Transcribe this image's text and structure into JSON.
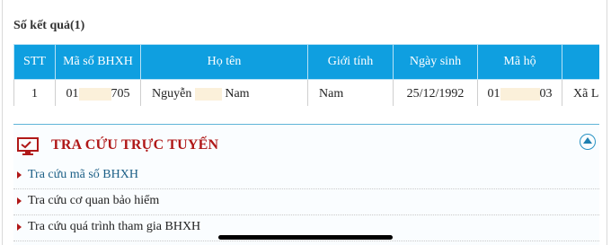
{
  "results": {
    "count_label": "Số kết quả(1)"
  },
  "table": {
    "headers": [
      "STT",
      "Mã số BHXH",
      "Họ tên",
      "Giới tính",
      "Ngày sinh",
      "Mã hộ",
      ""
    ],
    "row": {
      "stt": "1",
      "bhxh_prefix": "01",
      "bhxh_suffix": "705",
      "name_prefix": "Nguyễn",
      "name_suffix": "Nam",
      "gender": "Nam",
      "dob": "25/12/1992",
      "ho_prefix": "01",
      "ho_suffix": "03",
      "address": "Xã L"
    }
  },
  "lookup": {
    "title": "TRA CỨU TRỰC TUYẾN",
    "links": [
      "Tra cứu mã số BHXH",
      "Tra cứu cơ quan bảo hiểm",
      "Tra cứu quá trình tham gia BHXH"
    ]
  },
  "colors": {
    "header_bg": "#0f9fe0",
    "title_red": "#b01818",
    "link_blue": "#1c5f86"
  }
}
